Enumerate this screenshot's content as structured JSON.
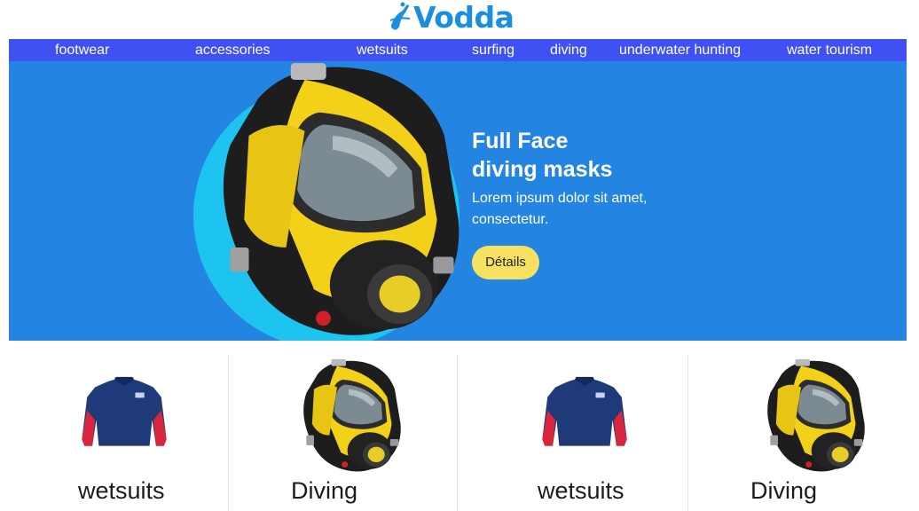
{
  "brand": {
    "name": "Vodda",
    "color": "#1a8fe0"
  },
  "nav": {
    "items": [
      {
        "label": "footwear"
      },
      {
        "label": "accessories"
      },
      {
        "label": "wetsuits"
      },
      {
        "label": "surfing"
      },
      {
        "label": "diving"
      },
      {
        "label": "underwater hunting"
      },
      {
        "label": "water tourism"
      }
    ],
    "background": "#3f51f2"
  },
  "hero": {
    "title_line1": "Full Face",
    "title_line2": "diving masks",
    "text_line1": "Lorem ipsum dolor sit amet,",
    "text_line2": "consectetur.",
    "button_label": "Détails",
    "background": "#2385e1",
    "circle_color": "#1cc4ef",
    "button_color": "#f7e163",
    "image": "full-face-diving-mask"
  },
  "categories": [
    {
      "label": "wetsuits",
      "image": "wetsuit-top"
    },
    {
      "label": "Diving",
      "image": "full-face-diving-mask"
    },
    {
      "label": "wetsuits",
      "image": "wetsuit-top"
    },
    {
      "label": "Diving",
      "image": "full-face-diving-mask"
    }
  ]
}
